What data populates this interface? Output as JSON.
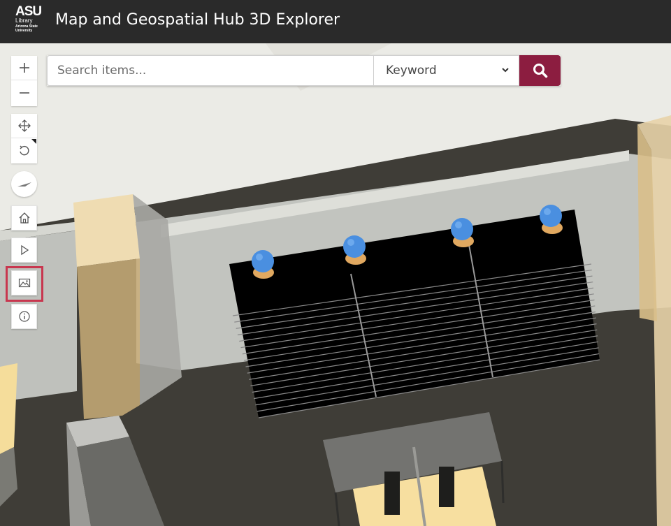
{
  "header": {
    "logo_mark": "ASU",
    "logo_line1": "Library",
    "logo_line2": "Arizona State",
    "logo_line3": "University",
    "title": "Map and Geospatial Hub 3D Explorer"
  },
  "search": {
    "placeholder": "Search items...",
    "mode_selected": "Keyword",
    "button_icon": "search-icon"
  },
  "toolbar": {
    "items": [
      {
        "icon": "zoom-in-icon"
      },
      {
        "icon": "zoom-out-icon"
      },
      {
        "icon": "pan-icon"
      },
      {
        "icon": "rotate-icon"
      },
      {
        "icon": "compass-icon"
      },
      {
        "icon": "home-icon"
      },
      {
        "icon": "play-icon"
      },
      {
        "icon": "basemap-gallery-icon",
        "highlighted": true
      },
      {
        "icon": "info-icon"
      }
    ]
  },
  "colors": {
    "header_bg": "#2a2a2a",
    "accent": "#8c1d40",
    "highlight": "#c8374f",
    "floor": "#3f3d37",
    "shelf": "#000000",
    "marker": "#4a8fe0",
    "marker_base": "#e0a860",
    "wall_beige": "#e8d3a8"
  },
  "scene": {
    "markers": 4
  }
}
